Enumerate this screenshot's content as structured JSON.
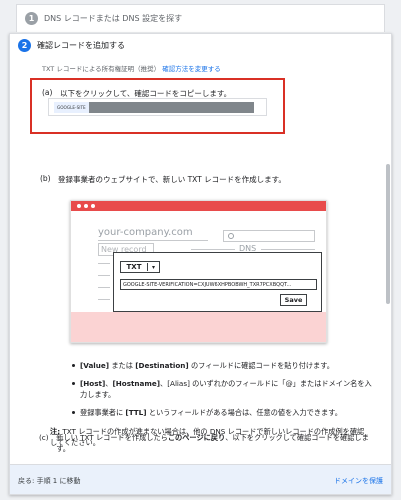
{
  "step1": {
    "number": "1",
    "label": "DNS レコードまたは DNS 設定を探す"
  },
  "step2": {
    "number": "2",
    "label": "確認レコードを追加する",
    "subline_prefix": "TXT レコードによる所有権証明（推奨）",
    "subline_link": "確認方法を変更する"
  },
  "stepA": {
    "marker": "(a)",
    "text": "以下をクリックして、確認コードをコピーします。",
    "code_prefix": "GOOGLE-SITE"
  },
  "stepB": {
    "marker": "(b)",
    "text": "登録事業者のウェブサイトで、新しい TXT レコードを作成します。"
  },
  "illustration": {
    "company": "your-company.com",
    "new_record": "New record",
    "dns_label": "DNS",
    "type_value": "TXT",
    "caret": "▾",
    "record_value": "GOOGLE-SITE-VERIFICATION=CXJUW6XHPBOBWH_TXR7PCXBQQT...",
    "save_label": "Save",
    "x_glyph": "×"
  },
  "bullets": [
    {
      "pre": "",
      "b1": "[Value]",
      "mid": " または ",
      "b2": "[Destination]",
      "post": " のフィールドに確認コードを貼り付けます。"
    },
    {
      "pre": "",
      "b1": "[Host]",
      "mid": "、",
      "b2": "[Hostname]",
      "post": "、[Alias] のいずれかのフィールドに「@」またはドメイン名を入力します。"
    },
    {
      "pre": "登録事業者に ",
      "b1": "[TTL]",
      "mid": "",
      "b2": "",
      "post": " というフィールドがある場合は、任意の値を入力できます。"
    }
  ],
  "note": {
    "bold": "注:",
    "text": " TXT レコードの作成が進まない場合は、他の DNS レコードで新しいレコードの作成例を確認してください。"
  },
  "stepC": {
    "marker": "(c)",
    "pre": "新しい TXT レコードを作成したら",
    "bold": "このページに戻り",
    "post": "、以下をクリックして確認コードを確認します。"
  },
  "footer": {
    "back": "戻る: 手順 1 に移動",
    "verify": "ドメインを保護"
  },
  "colors": {
    "accent": "#1a73e8",
    "highlight": "#d93025",
    "illustration_red": "#e84b4b"
  }
}
